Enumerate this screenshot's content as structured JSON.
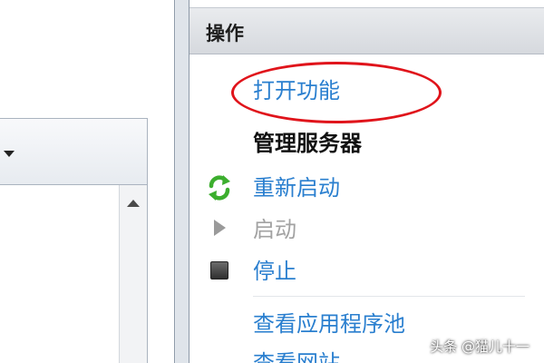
{
  "actions_panel": {
    "title": "操作",
    "open_feature": "打开功能",
    "manage_server_title": "管理服务器",
    "restart": "重新启动",
    "start": "启动",
    "stop": "停止",
    "view_app_pools": "查看应用程序池",
    "view_sites": "查看网站"
  },
  "watermark": "头条 @猫儿十一",
  "colors": {
    "link": "#2a7fcf",
    "disabled": "#a2a2a2",
    "highlight_ellipse": "#e0141b",
    "refresh_icon": "#3cae2e"
  }
}
